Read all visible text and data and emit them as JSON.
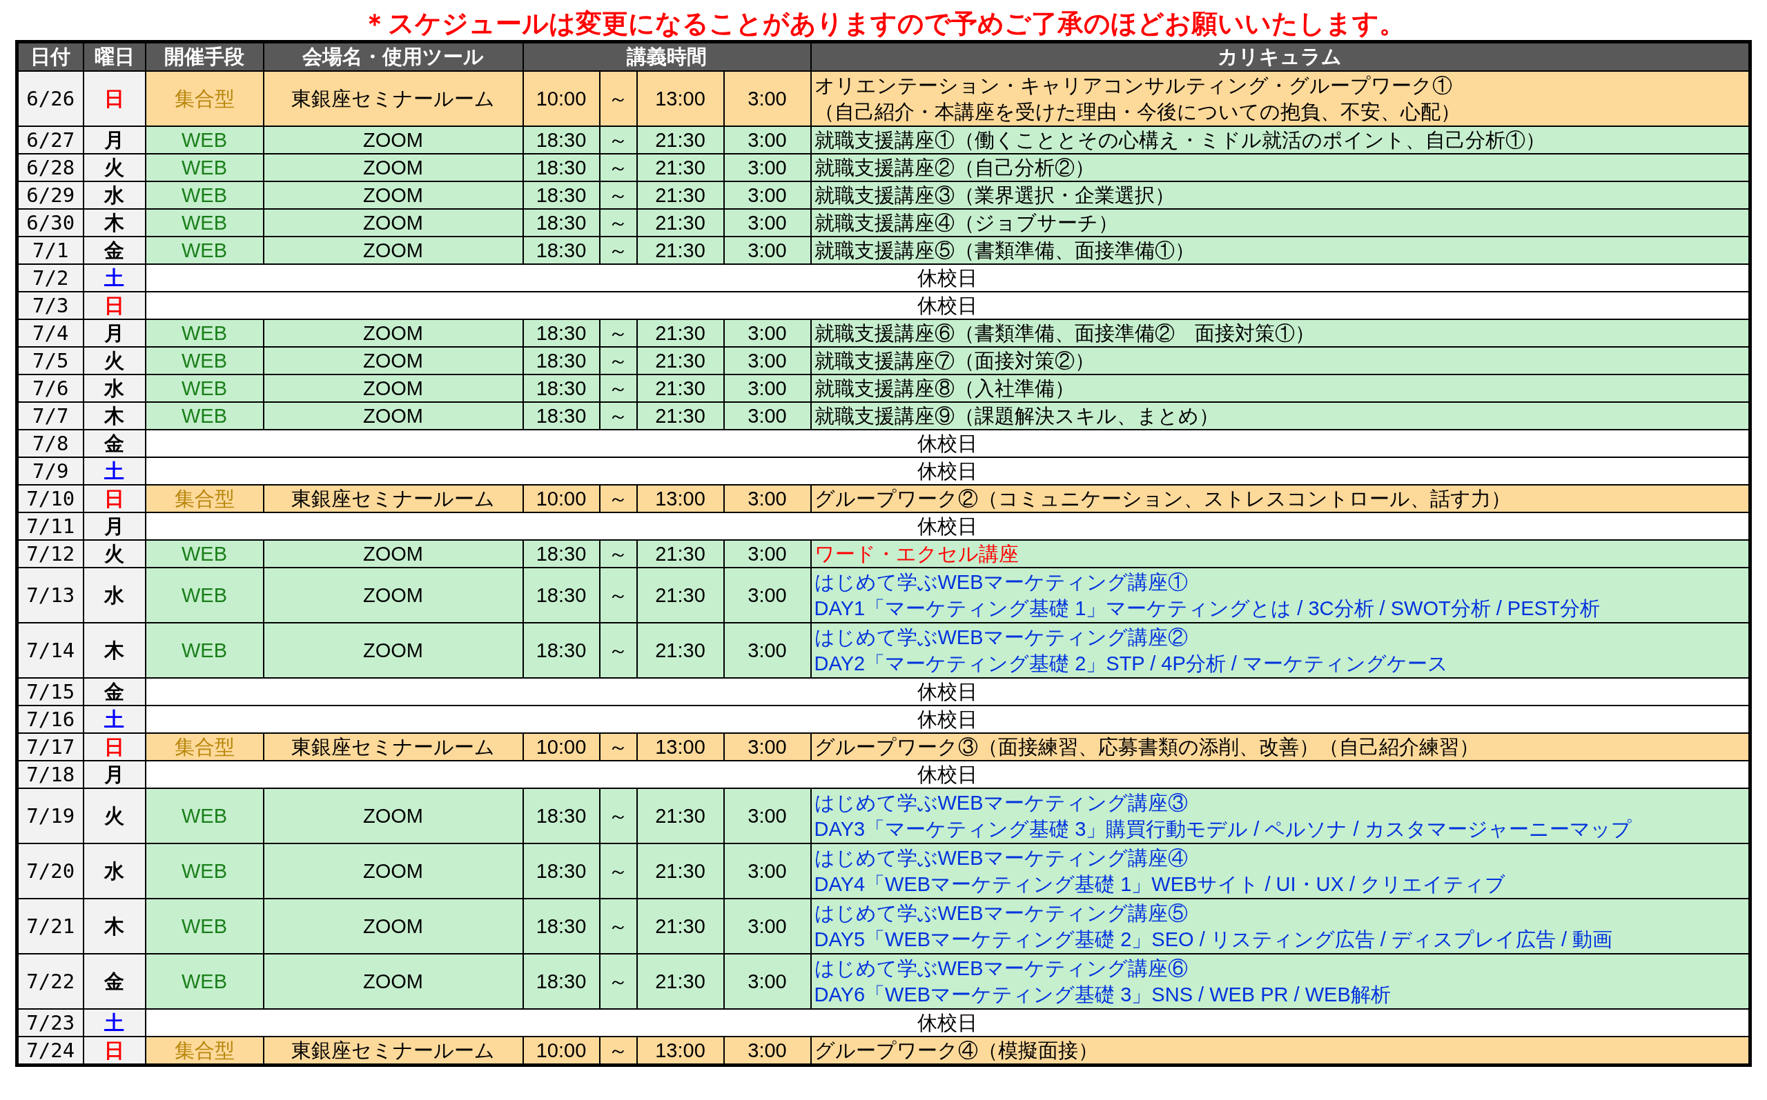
{
  "notice": "＊スケジュールは変更になることがありますので予めご了承のほどお願いいたします。",
  "columns": {
    "date": "日付",
    "day": "曜日",
    "method": "開催手段",
    "venue": "会場名・使用ツール",
    "time": "講義時間",
    "curriculum": "カリキュラム"
  },
  "rows": [
    {
      "kind": "venue",
      "date": "6/26",
      "day": {
        "text": "日",
        "color": "#ff0000"
      },
      "method": "集合型",
      "venue": "東銀座セミナールーム",
      "start": "10:00",
      "sep": "～",
      "end": "13:00",
      "duration": "3:00",
      "curriculum": {
        "color": "#000000",
        "lines": [
          "オリエンテーション・キャリアコンサルティング・グループワーク①",
          "（自己紹介・本講座を受けた理由・今後についての抱負、不安、心配）"
        ]
      }
    },
    {
      "kind": "web",
      "date": "6/27",
      "day": {
        "text": "月",
        "color": "#000000"
      },
      "method": "WEB",
      "venue": "ZOOM",
      "start": "18:30",
      "sep": "～",
      "end": "21:30",
      "duration": "3:00",
      "curriculum": {
        "color": "#000000",
        "lines": [
          "就職支援講座①（働くこととその心構え・ミドル就活のポイント、自己分析①）"
        ]
      }
    },
    {
      "kind": "web",
      "date": "6/28",
      "day": {
        "text": "火",
        "color": "#000000"
      },
      "method": "WEB",
      "venue": "ZOOM",
      "start": "18:30",
      "sep": "～",
      "end": "21:30",
      "duration": "3:00",
      "curriculum": {
        "color": "#000000",
        "lines": [
          "就職支援講座②（自己分析②）"
        ]
      }
    },
    {
      "kind": "web",
      "date": "6/29",
      "day": {
        "text": "水",
        "color": "#000000"
      },
      "method": "WEB",
      "venue": "ZOOM",
      "start": "18:30",
      "sep": "～",
      "end": "21:30",
      "duration": "3:00",
      "curriculum": {
        "color": "#000000",
        "lines": [
          "就職支援講座③（業界選択・企業選択）"
        ]
      }
    },
    {
      "kind": "web",
      "date": "6/30",
      "day": {
        "text": "木",
        "color": "#000000"
      },
      "method": "WEB",
      "venue": "ZOOM",
      "start": "18:30",
      "sep": "～",
      "end": "21:30",
      "duration": "3:00",
      "curriculum": {
        "color": "#000000",
        "lines": [
          "就職支援講座④（ジョブサーチ）"
        ]
      }
    },
    {
      "kind": "web",
      "date": "7/1",
      "day": {
        "text": "金",
        "color": "#000000"
      },
      "method": "WEB",
      "venue": "ZOOM",
      "start": "18:30",
      "sep": "～",
      "end": "21:30",
      "duration": "3:00",
      "curriculum": {
        "color": "#000000",
        "lines": [
          "就職支援講座⑤（書類準備、面接準備①）"
        ]
      }
    },
    {
      "kind": "holiday",
      "date": "7/2",
      "day": {
        "text": "土",
        "color": "#0000ff"
      },
      "label": "休校日"
    },
    {
      "kind": "holiday",
      "date": "7/3",
      "day": {
        "text": "日",
        "color": "#ff0000"
      },
      "label": "休校日"
    },
    {
      "kind": "web",
      "date": "7/4",
      "day": {
        "text": "月",
        "color": "#000000"
      },
      "method": "WEB",
      "venue": "ZOOM",
      "start": "18:30",
      "sep": "～",
      "end": "21:30",
      "duration": "3:00",
      "curriculum": {
        "color": "#000000",
        "lines": [
          "就職支援講座⑥（書類準備、面接準備②　面接対策①）"
        ]
      }
    },
    {
      "kind": "web",
      "date": "7/5",
      "day": {
        "text": "火",
        "color": "#000000"
      },
      "method": "WEB",
      "venue": "ZOOM",
      "start": "18:30",
      "sep": "～",
      "end": "21:30",
      "duration": "3:00",
      "curriculum": {
        "color": "#000000",
        "lines": [
          "就職支援講座⑦（面接対策②）"
        ]
      }
    },
    {
      "kind": "web",
      "date": "7/6",
      "day": {
        "text": "水",
        "color": "#000000"
      },
      "method": "WEB",
      "venue": "ZOOM",
      "start": "18:30",
      "sep": "～",
      "end": "21:30",
      "duration": "3:00",
      "curriculum": {
        "color": "#000000",
        "lines": [
          "就職支援講座⑧（入社準備）"
        ]
      }
    },
    {
      "kind": "web",
      "date": "7/7",
      "day": {
        "text": "木",
        "color": "#000000"
      },
      "method": "WEB",
      "venue": "ZOOM",
      "start": "18:30",
      "sep": "～",
      "end": "21:30",
      "duration": "3:00",
      "curriculum": {
        "color": "#000000",
        "lines": [
          "就職支援講座⑨（課題解決スキル、まとめ）"
        ]
      }
    },
    {
      "kind": "holiday",
      "date": "7/8",
      "day": {
        "text": "金",
        "color": "#000000"
      },
      "label": "休校日"
    },
    {
      "kind": "holiday",
      "date": "7/9",
      "day": {
        "text": "土",
        "color": "#0000ff"
      },
      "label": "休校日"
    },
    {
      "kind": "venue",
      "date": "7/10",
      "day": {
        "text": "日",
        "color": "#ff0000"
      },
      "method": "集合型",
      "venue": "東銀座セミナールーム",
      "start": "10:00",
      "sep": "～",
      "end": "13:00",
      "duration": "3:00",
      "curriculum": {
        "color": "#000000",
        "lines": [
          "グループワーク②（コミュニケーション、ストレスコントロール、話す力）"
        ]
      }
    },
    {
      "kind": "holiday",
      "date": "7/11",
      "day": {
        "text": "月",
        "color": "#000000"
      },
      "label": "休校日"
    },
    {
      "kind": "web",
      "date": "7/12",
      "day": {
        "text": "火",
        "color": "#000000"
      },
      "method": "WEB",
      "venue": "ZOOM",
      "start": "18:30",
      "sep": "～",
      "end": "21:30",
      "duration": "3:00",
      "curriculum": {
        "color": "#ff0000",
        "lines": [
          "ワード・エクセル講座"
        ]
      }
    },
    {
      "kind": "web",
      "date": "7/13",
      "day": {
        "text": "水",
        "color": "#000000"
      },
      "method": "WEB",
      "venue": "ZOOM",
      "start": "18:30",
      "sep": "～",
      "end": "21:30",
      "duration": "3:00",
      "curriculum": {
        "color": "#0033dd",
        "lines": [
          "はじめて学ぶWEBマーケティング講座①",
          "DAY1「マーケティング基礎 1」マーケティングとは / 3C分析 / SWOT分析 / PEST分析"
        ]
      }
    },
    {
      "kind": "web",
      "date": "7/14",
      "day": {
        "text": "木",
        "color": "#000000"
      },
      "method": "WEB",
      "venue": "ZOOM",
      "start": "18:30",
      "sep": "～",
      "end": "21:30",
      "duration": "3:00",
      "curriculum": {
        "color": "#0033dd",
        "lines": [
          "はじめて学ぶWEBマーケティング講座②",
          "DAY2「マーケティング基礎 2」STP / 4P分析 / マーケティングケース"
        ]
      }
    },
    {
      "kind": "holiday",
      "date": "7/15",
      "day": {
        "text": "金",
        "color": "#000000"
      },
      "label": "休校日"
    },
    {
      "kind": "holiday",
      "date": "7/16",
      "day": {
        "text": "土",
        "color": "#0000ff"
      },
      "label": "休校日"
    },
    {
      "kind": "venue",
      "date": "7/17",
      "day": {
        "text": "日",
        "color": "#ff0000"
      },
      "method": "集合型",
      "venue": "東銀座セミナールーム",
      "start": "10:00",
      "sep": "～",
      "end": "13:00",
      "duration": "3:00",
      "curriculum": {
        "color": "#000000",
        "lines": [
          "グループワーク③（面接練習、応募書類の添削、改善）（自己紹介練習）"
        ]
      }
    },
    {
      "kind": "holiday",
      "date": "7/18",
      "day": {
        "text": "月",
        "color": "#000000"
      },
      "label": "休校日"
    },
    {
      "kind": "web",
      "date": "7/19",
      "day": {
        "text": "火",
        "color": "#000000"
      },
      "method": "WEB",
      "venue": "ZOOM",
      "start": "18:30",
      "sep": "～",
      "end": "21:30",
      "duration": "3:00",
      "curriculum": {
        "color": "#0033dd",
        "lines": [
          "はじめて学ぶWEBマーケティング講座③",
          "DAY3「マーケティング基礎 3」購買行動モデル / ペルソナ / カスタマージャーニーマップ"
        ]
      }
    },
    {
      "kind": "web",
      "date": "7/20",
      "day": {
        "text": "水",
        "color": "#000000"
      },
      "method": "WEB",
      "venue": "ZOOM",
      "start": "18:30",
      "sep": "～",
      "end": "21:30",
      "duration": "3:00",
      "curriculum": {
        "color": "#0033dd",
        "lines": [
          "はじめて学ぶWEBマーケティング講座④",
          "DAY4「WEBマーケティング基礎 1」WEBサイト / UI・UX / クリエイティブ"
        ]
      }
    },
    {
      "kind": "web",
      "date": "7/21",
      "day": {
        "text": "木",
        "color": "#000000"
      },
      "method": "WEB",
      "venue": "ZOOM",
      "start": "18:30",
      "sep": "～",
      "end": "21:30",
      "duration": "3:00",
      "curriculum": {
        "color": "#0033dd",
        "lines": [
          "はじめて学ぶWEBマーケティング講座⑤",
          "DAY5「WEBマーケティング基礎 2」SEO / リスティング広告 / ディスプレイ広告 / 動画"
        ]
      }
    },
    {
      "kind": "web",
      "date": "7/22",
      "day": {
        "text": "金",
        "color": "#000000"
      },
      "method": "WEB",
      "venue": "ZOOM",
      "start": "18:30",
      "sep": "～",
      "end": "21:30",
      "duration": "3:00",
      "curriculum": {
        "color": "#0033dd",
        "lines": [
          "はじめて学ぶWEBマーケティング講座⑥",
          "DAY6「WEBマーケティング基礎 3」SNS / WEB PR / WEB解析"
        ]
      }
    },
    {
      "kind": "holiday",
      "date": "7/23",
      "day": {
        "text": "土",
        "color": "#0000ff"
      },
      "label": "休校日"
    },
    {
      "kind": "venue",
      "date": "7/24",
      "day": {
        "text": "日",
        "color": "#ff0000"
      },
      "method": "集合型",
      "venue": "東銀座セミナールーム",
      "start": "10:00",
      "sep": "～",
      "end": "13:00",
      "duration": "3:00",
      "curriculum": {
        "color": "#000000",
        "lines": [
          "グループワーク④（模擬面接）"
        ]
      }
    }
  ]
}
